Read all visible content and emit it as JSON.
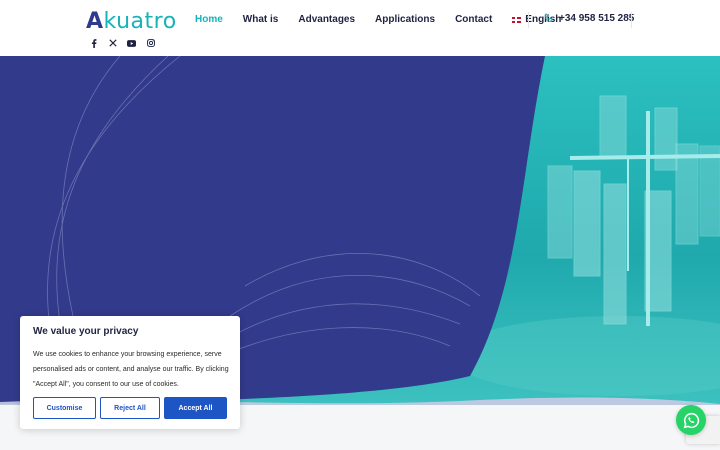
{
  "header": {
    "logo_text_first": "A",
    "logo_text_rest": "kuatro",
    "socials": [
      {
        "name": "facebook-icon"
      },
      {
        "name": "x-icon"
      },
      {
        "name": "youtube-icon"
      },
      {
        "name": "instagram-icon"
      }
    ],
    "nav": {
      "home": "Home",
      "what_is": "What is",
      "advantages": "Advantages",
      "applications": "Applications",
      "contact": "Contact",
      "language": "English"
    },
    "phone": "+34 958 515 285"
  },
  "colors": {
    "navy": "#323a8c",
    "teal": "#17b3b9",
    "accent_blue": "#1e55c5",
    "whatsapp": "#25d366"
  },
  "cookie": {
    "title": "We value your privacy",
    "text": "We use cookies to enhance your browsing experience, serve personalised ads or content, and analyse our traffic. By clicking \"Accept All\", you consent to our use of cookies.",
    "customise": "Customise",
    "reject": "Reject All",
    "accept": "Accept All"
  }
}
